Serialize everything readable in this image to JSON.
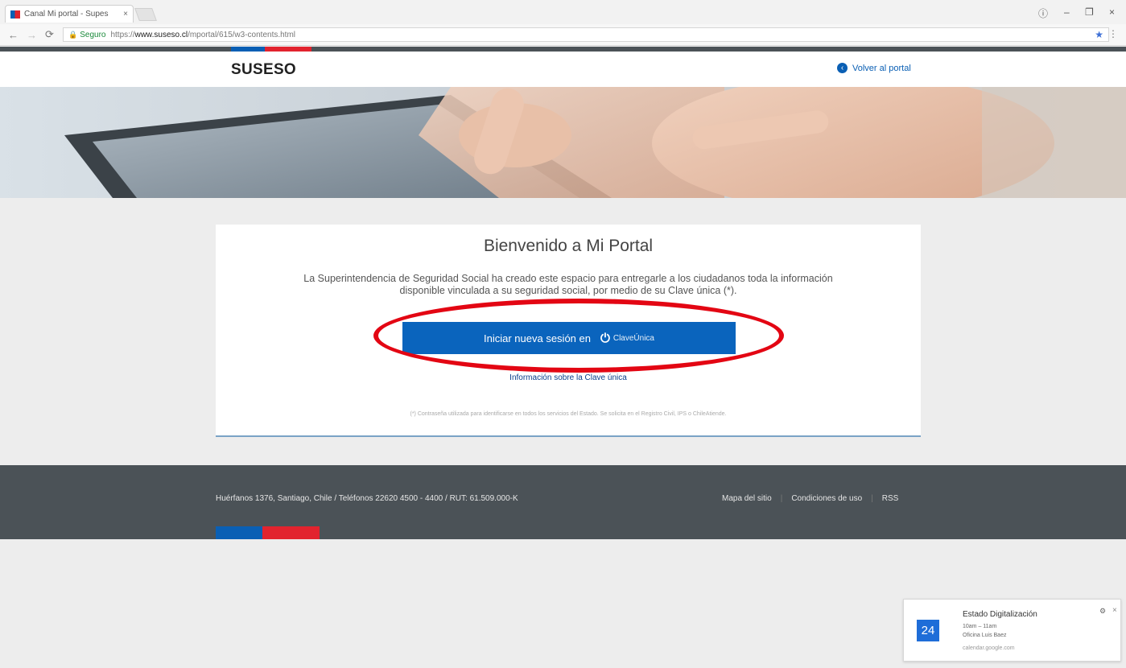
{
  "browser": {
    "tab_title": "Canal Mi portal - Supes",
    "tab_close": "×",
    "secure_label": "Seguro",
    "url_prefix": "https://",
    "url_host": "www.suseso.cl",
    "url_path": "/mportal/615/w3-contents.html",
    "window_controls": [
      "–",
      "❐",
      "×"
    ],
    "account_icon": "ⓘ"
  },
  "site": {
    "brand": "SUSESO",
    "back_link": "Volver al portal",
    "colors": {
      "blue": "#0a5fb4",
      "red": "#e2232e",
      "dark": "#4b5257"
    }
  },
  "card": {
    "title": "Bienvenido a Mi Portal",
    "description": "La Superintendencia de Seguridad Social ha creado este espacio para entregarle a los ciudadanos toda la información disponible vinculada a su seguridad social, por medio de su Clave única (*).",
    "login_button": "Iniciar nueva sesión en",
    "login_brand": "ClaveÚnica",
    "info_link": "Información sobre la Clave única",
    "footnote": "(*) Contraseña utilizada para identificarse en todos los servicios del Estado. Se solicita en el Registro Civil, IPS o ChileAtiende."
  },
  "footer": {
    "address": "Huérfanos 1376, Santiago, Chile / Teléfonos 22620 4500 - 4400 / RUT: 61.509.000-K",
    "links": [
      "Mapa del sitio",
      "Condiciones de uso",
      "RSS"
    ]
  },
  "notification": {
    "calendar_day": "24",
    "title": "Estado Digitalización",
    "time": "10am – 11am",
    "place": "Oficina Luis Baez",
    "source": "calendar.google.com"
  }
}
